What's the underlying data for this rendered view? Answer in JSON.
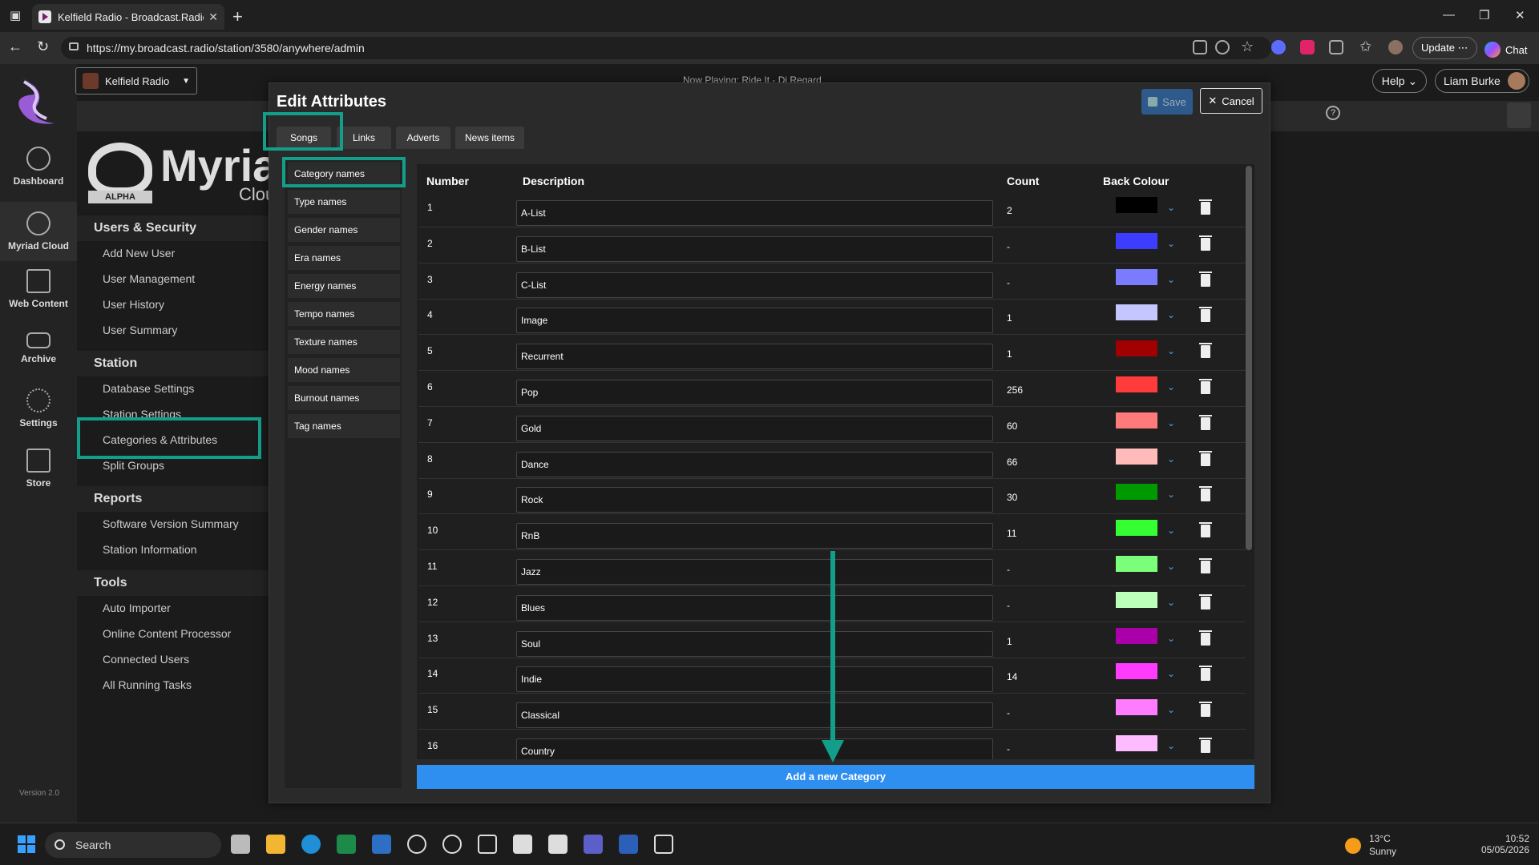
{
  "browser": {
    "tab_title": "Kelfield Radio - Broadcast.Radio Po",
    "url": "https://my.broadcast.radio/station/3580/anywhere/admin",
    "update_label": "Update",
    "chat_label": "Chat"
  },
  "app": {
    "station": "Kelfield Radio",
    "now_playing_label": "Now Playing:",
    "now_playing_track": "Ride It - Dj Regard",
    "help_label": "Help",
    "user_name": "Liam Burke",
    "version": "Version 2.0",
    "nav": [
      {
        "label": "Dashboard",
        "icon": "dashboard-icon"
      },
      {
        "label": "Myriad Cloud",
        "icon": "cloud-icon"
      },
      {
        "label": "Web Content",
        "icon": "web-content-icon"
      },
      {
        "label": "Archive",
        "icon": "archive-icon"
      },
      {
        "label": "Settings",
        "icon": "gear-icon"
      },
      {
        "label": "Store",
        "icon": "store-icon"
      }
    ]
  },
  "logo": {
    "word": "Myriad",
    "sub": "Cloud",
    "badge": "ALPHA"
  },
  "sidebar": {
    "sections": [
      {
        "title": "Users & Security",
        "items": [
          "Add New User",
          "User Management",
          "User History",
          "User Summary"
        ]
      },
      {
        "title": "Station",
        "items": [
          "Database Settings",
          "Station Settings",
          "Categories & Attributes",
          "Split Groups"
        ]
      },
      {
        "title": "Reports",
        "items": [
          "Software Version Summary",
          "Station Information"
        ]
      },
      {
        "title": "Tools",
        "items": [
          "Auto Importer",
          "Online Content Processor",
          "Connected Users",
          "All Running Tasks"
        ]
      }
    ]
  },
  "modal": {
    "title": "Edit Attributes",
    "save_label": "Save",
    "cancel_label": "Cancel",
    "tabs": [
      "Songs",
      "Links",
      "Adverts",
      "News items"
    ],
    "submenu": [
      "Category names",
      "Type names",
      "Gender names",
      "Era names",
      "Energy names",
      "Tempo names",
      "Texture names",
      "Mood names",
      "Burnout names",
      "Tag names"
    ],
    "columns": [
      "Number",
      "Description",
      "Count",
      "Back Colour"
    ],
    "rows": [
      {
        "num": "1",
        "desc": "A-List",
        "count": "2",
        "color": "#000000"
      },
      {
        "num": "2",
        "desc": "B-List",
        "count": "-",
        "color": "#3d3dff"
      },
      {
        "num": "3",
        "desc": "C-List",
        "count": "-",
        "color": "#7b7bff"
      },
      {
        "num": "4",
        "desc": "Image",
        "count": "1",
        "color": "#c6c6ff"
      },
      {
        "num": "5",
        "desc": "Recurrent",
        "count": "1",
        "color": "#a00000"
      },
      {
        "num": "6",
        "desc": "Pop",
        "count": "256",
        "color": "#ff3b3b"
      },
      {
        "num": "7",
        "desc": "Gold",
        "count": "60",
        "color": "#ff7b7b"
      },
      {
        "num": "8",
        "desc": "Dance",
        "count": "66",
        "color": "#ffbaba"
      },
      {
        "num": "9",
        "desc": "Rock",
        "count": "30",
        "color": "#009900"
      },
      {
        "num": "10",
        "desc": "RnB",
        "count": "11",
        "color": "#33ff33"
      },
      {
        "num": "11",
        "desc": "Jazz",
        "count": "-",
        "color": "#7bff7b"
      },
      {
        "num": "12",
        "desc": "Blues",
        "count": "-",
        "color": "#bbffbb"
      },
      {
        "num": "13",
        "desc": "Soul",
        "count": "1",
        "color": "#aa00aa"
      },
      {
        "num": "14",
        "desc": "Indie",
        "count": "14",
        "color": "#ff3bff"
      },
      {
        "num": "15",
        "desc": "Classical",
        "count": "-",
        "color": "#ff7bff"
      },
      {
        "num": "16",
        "desc": "Country",
        "count": "-",
        "color": "#ffbbff"
      }
    ],
    "add_label": "Add a new Category"
  },
  "taskbar": {
    "search_label": "Search",
    "temp": "13°C",
    "condition": "Sunny",
    "time": "10:52",
    "date": "05/05/2026"
  },
  "colors": {
    "highlight": "#139e8a",
    "accent": "#2f8ff0"
  }
}
